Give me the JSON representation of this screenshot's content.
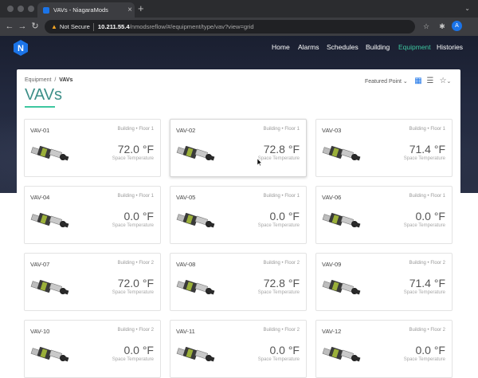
{
  "browser": {
    "tab_title": "VAVs - NiagaraMods",
    "tab_close": "×",
    "new_tab": "+",
    "security_label": "Not Secure",
    "url_host": "10.211.55.4",
    "url_path": "/nmodsreflow/#/equipment/type/vav?view=grid",
    "profile_initial": "A"
  },
  "nav": {
    "items": [
      {
        "label": "Home",
        "active": false
      },
      {
        "label": "Alarms",
        "active": false
      },
      {
        "label": "Schedules",
        "active": false
      },
      {
        "label": "Building",
        "active": false
      },
      {
        "label": "Equipment",
        "active": true
      },
      {
        "label": "Histories",
        "active": false
      }
    ],
    "active_color": "#3ec7a0"
  },
  "logo": {
    "letter": "N",
    "color": "#1b74e8"
  },
  "page": {
    "breadcrumb_root": "Equipment",
    "breadcrumb_sep": "/",
    "breadcrumb_current": "VAVs",
    "title": "VAVs",
    "featured_label": "Featured Point",
    "featured_chevron": "⌄"
  },
  "cards": [
    {
      "name": "VAV-01",
      "location": "Building • Floor 1",
      "value": "72.0 °F",
      "label": "Space Temperature"
    },
    {
      "name": "VAV-02",
      "location": "Building • Floor 1",
      "value": "72.8 °F",
      "label": "Space Temperature"
    },
    {
      "name": "VAV-03",
      "location": "Building • Floor 1",
      "value": "71.4 °F",
      "label": "Space Temperature"
    },
    {
      "name": "VAV-04",
      "location": "Building • Floor 1",
      "value": "0.0 °F",
      "label": "Space Temperature"
    },
    {
      "name": "VAV-05",
      "location": "Building • Floor 1",
      "value": "0.0 °F",
      "label": "Space Temperature"
    },
    {
      "name": "VAV-06",
      "location": "Building • Floor 1",
      "value": "0.0 °F",
      "label": "Space Temperature"
    },
    {
      "name": "VAV-07",
      "location": "Building • Floor 2",
      "value": "72.0 °F",
      "label": "Space Temperature"
    },
    {
      "name": "VAV-08",
      "location": "Building • Floor 2",
      "value": "72.8 °F",
      "label": "Space Temperature"
    },
    {
      "name": "VAV-09",
      "location": "Building • Floor 2",
      "value": "71.4 °F",
      "label": "Space Temperature"
    },
    {
      "name": "VAV-10",
      "location": "Building • Floor 2",
      "value": "0.0 °F",
      "label": "Space Temperature"
    },
    {
      "name": "VAV-11",
      "location": "Building • Floor 2",
      "value": "0.0 °F",
      "label": "Space Temperature"
    },
    {
      "name": "VAV-12",
      "location": "Building • Floor 2",
      "value": "0.0 °F",
      "label": "Space Temperature"
    }
  ]
}
